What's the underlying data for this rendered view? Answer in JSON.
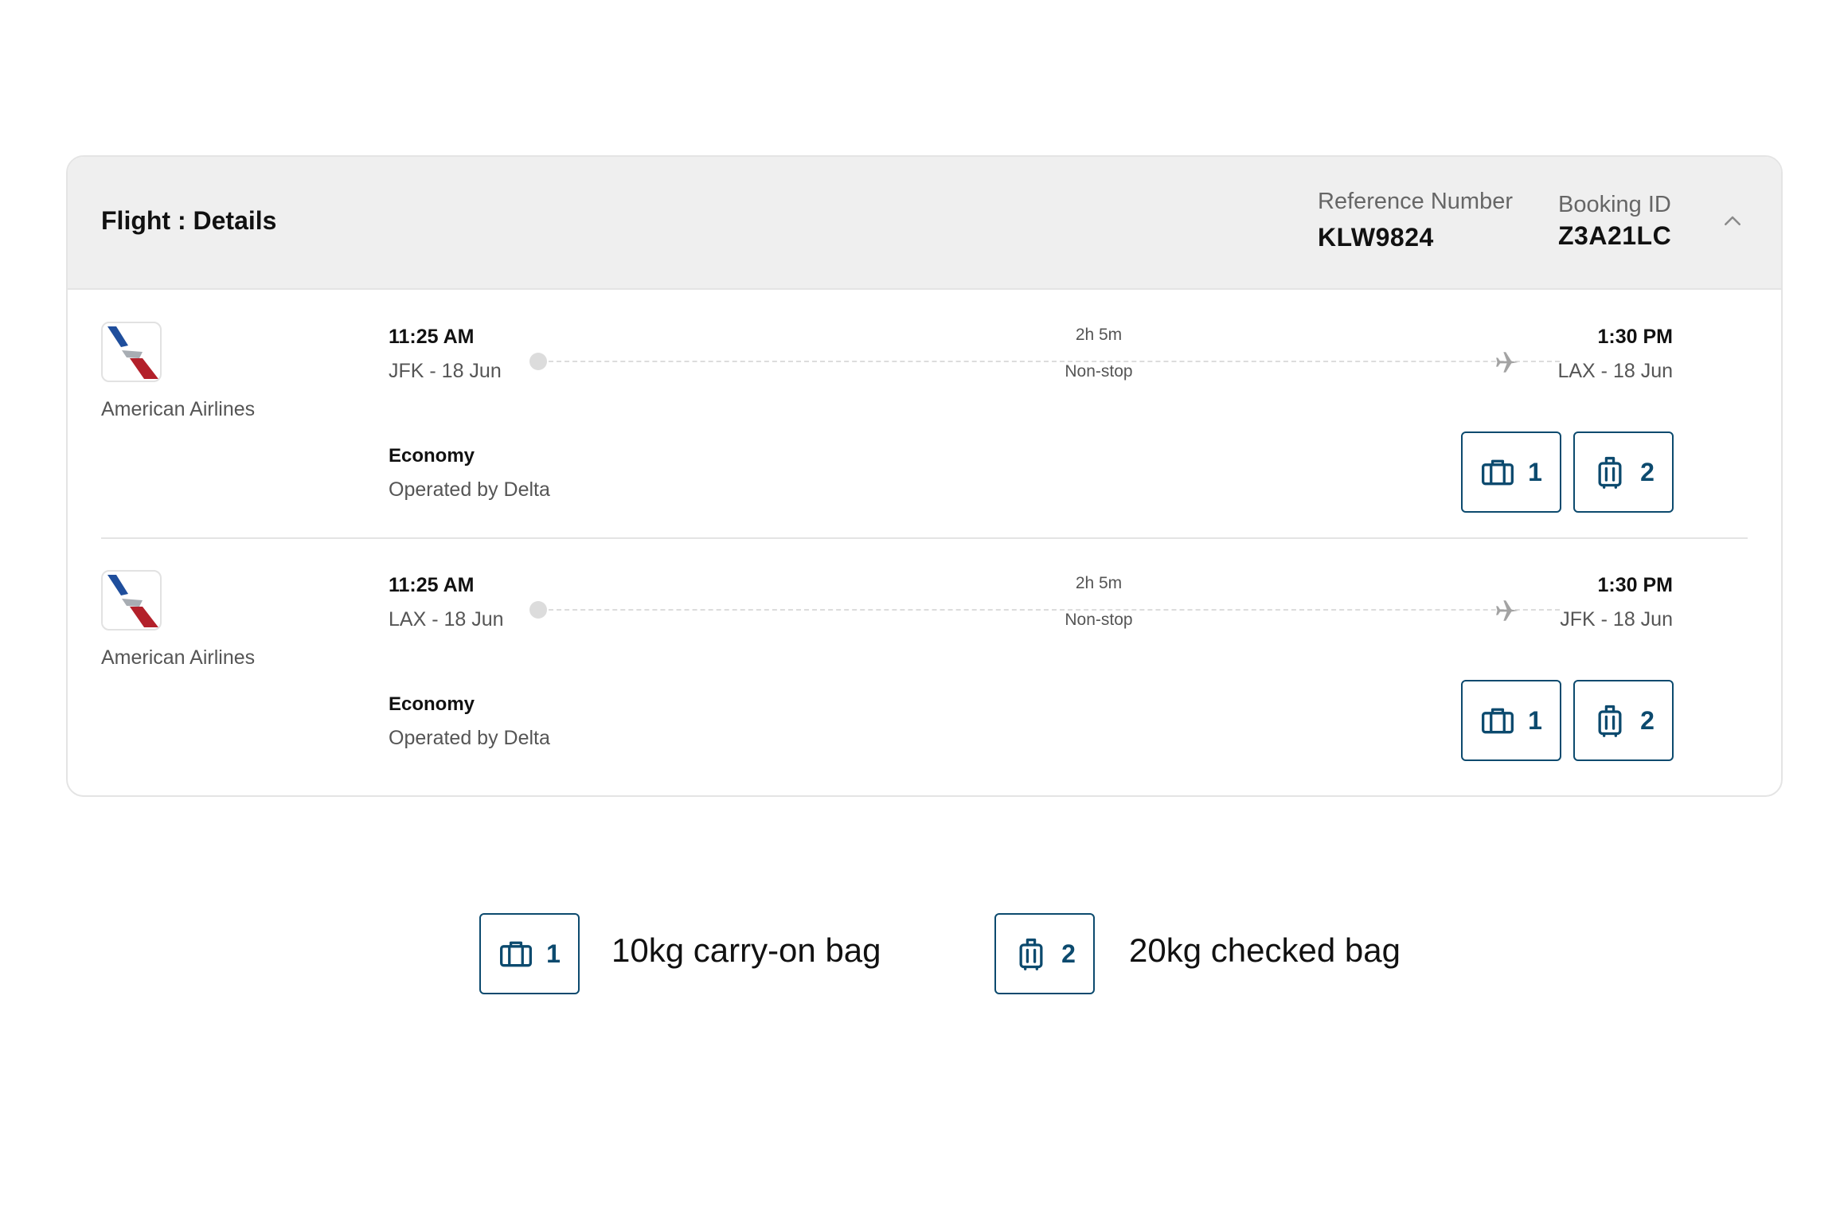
{
  "header": {
    "title": "Flight : Details",
    "reference_label": "Reference Number",
    "reference_value": "KLW9824",
    "booking_label": "Booking ID",
    "booking_value": "Z3A21LC",
    "collapse_icon": "chevron-up-icon"
  },
  "flights": [
    {
      "airline": "American Airlines",
      "departure_time": "11:25 AM",
      "departure_place": "JFK - 18 Jun",
      "arrival_time": "1:30 PM",
      "arrival_place": "LAX - 18 Jun",
      "duration": "2h 5m",
      "stops": "Non-stop",
      "cabin": "Economy",
      "operator": "Operated by Delta",
      "carry_on_count": "1",
      "checked_count": "2"
    },
    {
      "airline": "American Airlines",
      "departure_time": "11:25 AM",
      "departure_place": "LAX - 18 Jun",
      "arrival_time": "1:30 PM",
      "arrival_place": "JFK - 18 Jun",
      "duration": "2h 5m",
      "stops": "Non-stop",
      "cabin": "Economy",
      "operator": "Operated by Delta",
      "carry_on_count": "1",
      "checked_count": "2"
    }
  ],
  "legend": {
    "carry_on_count": "1",
    "carry_on_text": "10kg carry-on bag",
    "checked_count": "2",
    "checked_text": "20kg checked bag"
  },
  "colors": {
    "accent": "#0c4a6e",
    "header_bg": "#efefef",
    "border": "#e4e4e4",
    "muted_text": "#555555",
    "logo_blue": "#1f4e9c",
    "logo_red": "#b3202a",
    "logo_silver": "#a8adb3"
  },
  "icons": {
    "airline_logo": "american-airlines-logo",
    "plane": "plane-icon",
    "carry_on": "carry-on-bag-icon",
    "checked": "checked-bag-icon"
  }
}
